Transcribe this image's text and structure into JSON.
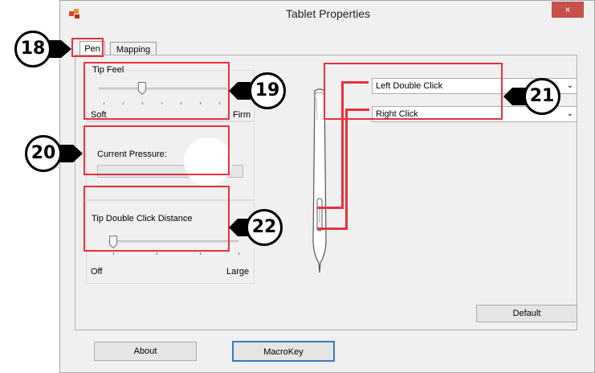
{
  "window": {
    "title": "Tablet Properties",
    "close_symbol": "×"
  },
  "tabs": [
    {
      "label": "Pen",
      "selected": true
    },
    {
      "label": "Mapping",
      "selected": false
    }
  ],
  "tip_feel": {
    "legend": "Tip Feel",
    "min_label": "Soft",
    "max_label": "Firm",
    "level": 0.3
  },
  "current_pressure": {
    "label": "Current Pressure:",
    "level": 0.0
  },
  "double_click": {
    "legend": "Tip Double Click Distance",
    "min_label": "Off",
    "max_label": "Large",
    "level": 0.0
  },
  "side_switch": {
    "upper_value": "Left Double Click",
    "lower_value": "Right Click"
  },
  "buttons": {
    "default": "Default",
    "about": "About",
    "macrokey": "MacroKey"
  },
  "callouts": {
    "c18": "18",
    "c19": "19",
    "c20": "20",
    "c21": "21",
    "c22": "22"
  },
  "colors": {
    "highlight": "#e8323c",
    "close": "#c7504c"
  }
}
